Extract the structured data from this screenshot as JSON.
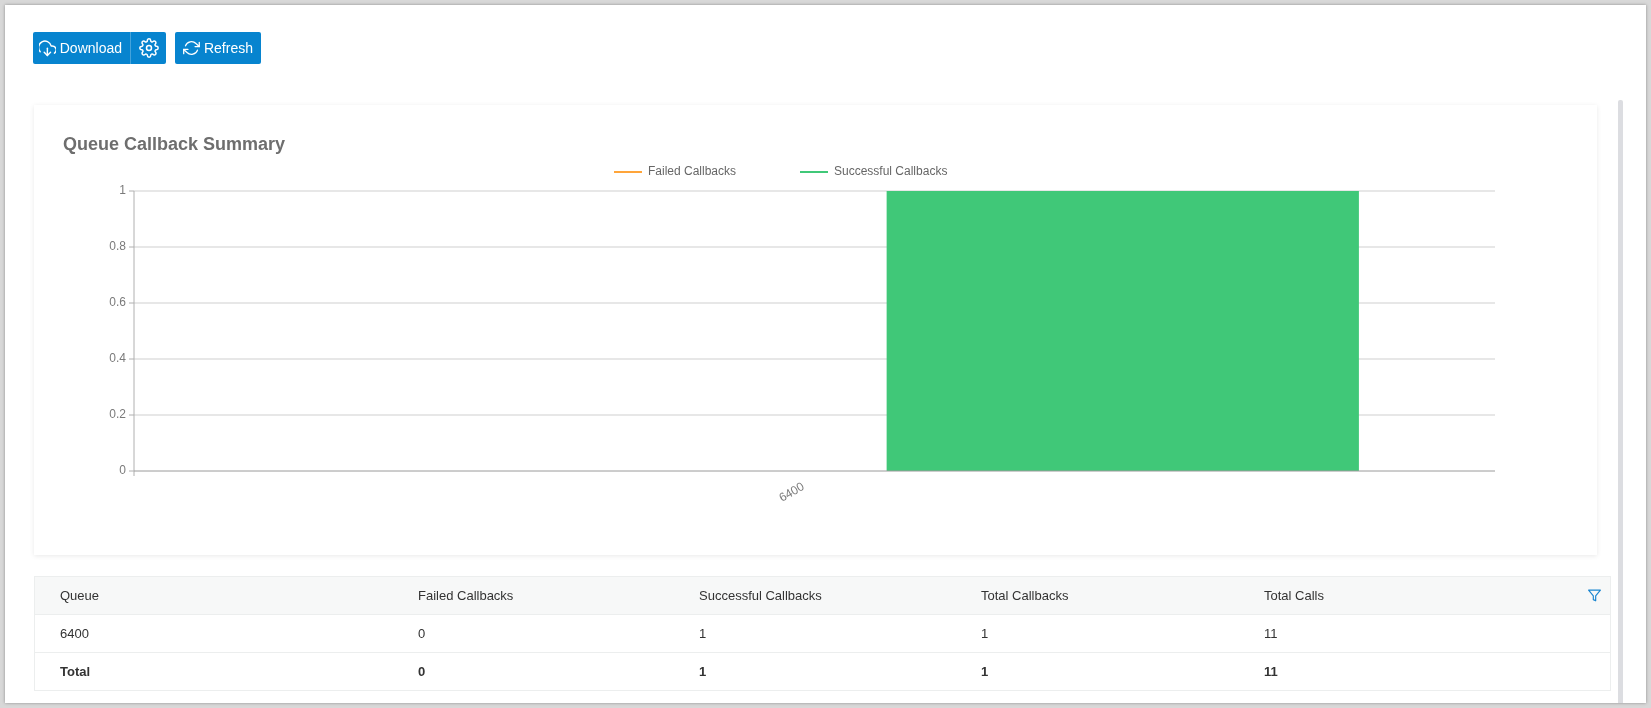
{
  "toolbar": {
    "download_button": {
      "label": "Download"
    },
    "refresh_button": {
      "label": "Refresh"
    }
  },
  "chart": {
    "chart_data": {
      "type": "bar",
      "title": "Queue Callback Summary",
      "categories": [
        "6400"
      ],
      "series": [
        {
          "name": "Failed Callbacks",
          "color": "#ffa53a",
          "values": [
            0
          ]
        },
        {
          "name": "Successful Callbacks",
          "color": "#40c878",
          "values": [
            1
          ]
        }
      ],
      "ylim": [
        0,
        1
      ],
      "yticks": [
        0,
        0.2,
        0.4,
        0.6,
        0.8,
        1
      ],
      "grid": true
    }
  },
  "table": {
    "columns": [
      "Queue",
      "Failed Callbacks",
      "Successful Callbacks",
      "Total Callbacks",
      "Total Calls"
    ],
    "rows": [
      [
        "6400",
        "0",
        "1",
        "1",
        "11"
      ]
    ],
    "total_row": [
      "Total",
      "0",
      "1",
      "1",
      "11"
    ]
  }
}
